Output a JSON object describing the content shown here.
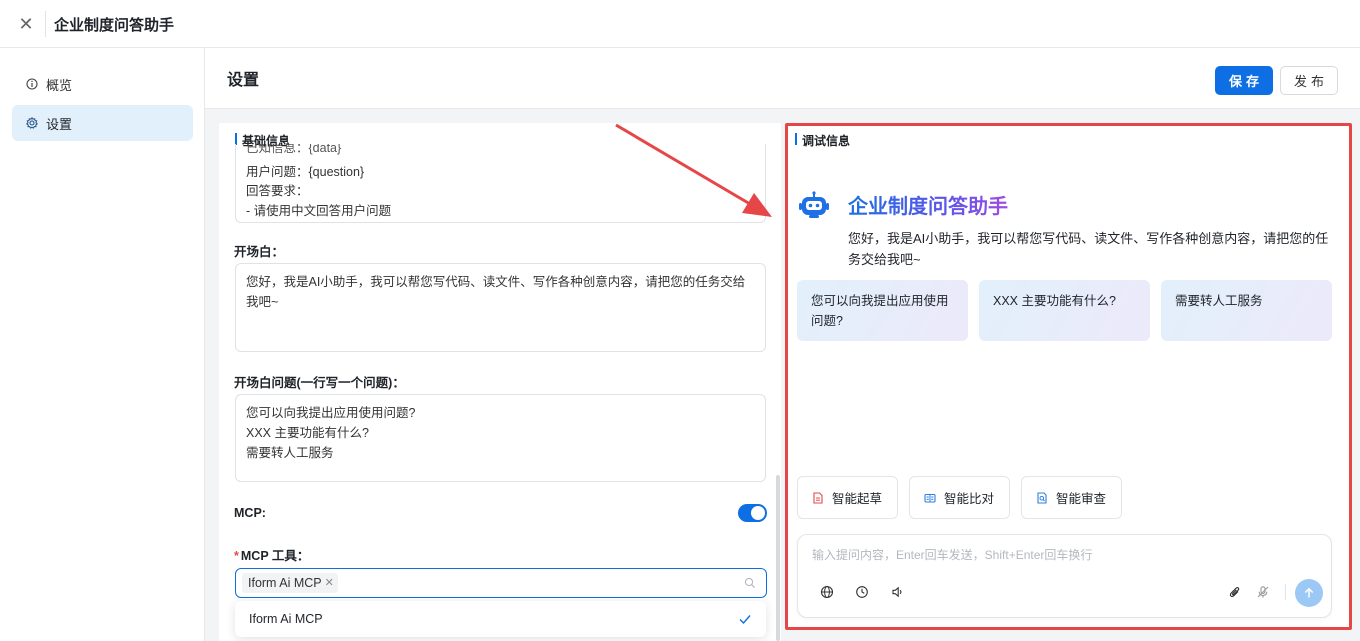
{
  "window": {
    "title": "企业制度问答助手"
  },
  "sidebar": {
    "items": [
      {
        "label": "概览",
        "icon": "info-circle-icon"
      },
      {
        "label": "设置",
        "icon": "gear-icon"
      }
    ]
  },
  "header": {
    "title": "设置",
    "save_label": "保存",
    "publish_label": "发布"
  },
  "config": {
    "basic_info_title": "基础信息",
    "prompt_lines": [
      "已知信息：{data}",
      "用户问题：{question}",
      "回答要求：",
      "- 请使用中文回答用户问题"
    ],
    "opening_label": "开场白：",
    "opening_text": "您好，我是AI小助手，我可以帮您写代码、读文件、写作各种创意内容，请把您的任务交给我吧~",
    "opening_lines": [
      "您好，我是AI小助手，我可以帮您写代码、读文件、写作各种创意内容，请把您的任务交给",
      "我吧~"
    ],
    "questions_label": "开场白问题(一行写一个问题)：",
    "questions": [
      "您可以向我提出应用使用问题?",
      "XXX 主要功能有什么?",
      "需要转人工服务"
    ],
    "mcp_label": "MCP:",
    "mcp_enabled": true,
    "mcp_tools_label": "MCP 工具：",
    "mcp_selected_tag": "Iform Ai MCP",
    "mcp_dropdown_option": "Iform Ai MCP"
  },
  "debug": {
    "title": "调试信息",
    "bot_name": "企业制度问答助手",
    "greeting": "您好，我是AI小助手，我可以帮您写代码、读文件、写作各种创意内容，请把您的任务交给我吧~",
    "suggestions": [
      "您可以向我提出应用使用问题?",
      "XXX 主要功能有什么?",
      "需要转人工服务"
    ],
    "tools": [
      {
        "label": "智能起草",
        "icon": "document-draft-icon",
        "color": "#e5484d"
      },
      {
        "label": "智能比对",
        "icon": "compare-book-icon",
        "color": "#2f7fe0"
      },
      {
        "label": "智能审查",
        "icon": "review-document-icon",
        "color": "#2f7fe0"
      }
    ],
    "input_placeholder": "输入提问内容，Enter回车发送，Shift+Enter回车换行"
  },
  "colors": {
    "primary": "#0d6fe3",
    "annotation_red": "#e74649"
  }
}
